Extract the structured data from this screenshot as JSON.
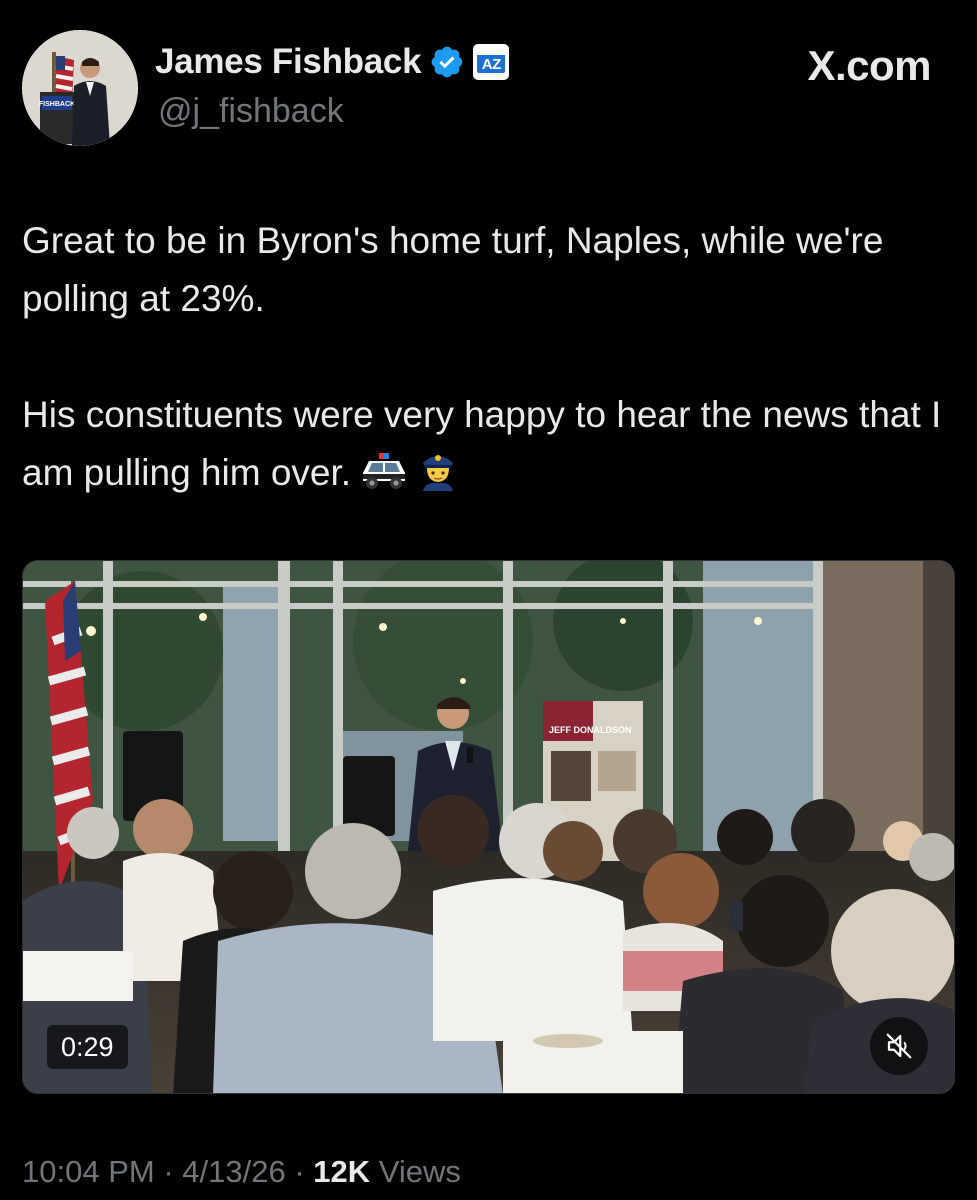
{
  "header": {
    "display_name": "James Fishback",
    "handle": "@j_fishback",
    "badge_text": "AZ",
    "site_logo": "X.com",
    "avatar_sign_text": "FISHBACK"
  },
  "tweet": {
    "paragraph_1": "Great to be in Byron's home turf, Naples, while we're polling at 23%.",
    "paragraph_2": "His constituents were very happy to hear the news that I am pulling him over.",
    "emojis": [
      "police-car",
      "police-officer"
    ]
  },
  "media": {
    "duration": "0:29",
    "muted": true,
    "sign_text": "JEFF DONALDSON"
  },
  "meta": {
    "time": "10:04 PM",
    "separator": "·",
    "date": "4/13/26",
    "views_count": "12K",
    "views_label": "Views"
  },
  "colors": {
    "background": "#000000",
    "text_primary": "#e7e9ea",
    "text_secondary": "#71767b",
    "verified_blue": "#1d9bf0",
    "badge_blue": "#1d6fd1"
  },
  "icons": [
    "verified-icon",
    "az-badge-icon",
    "x-logo",
    "police-car-emoji",
    "police-officer-emoji",
    "mute-icon"
  ]
}
